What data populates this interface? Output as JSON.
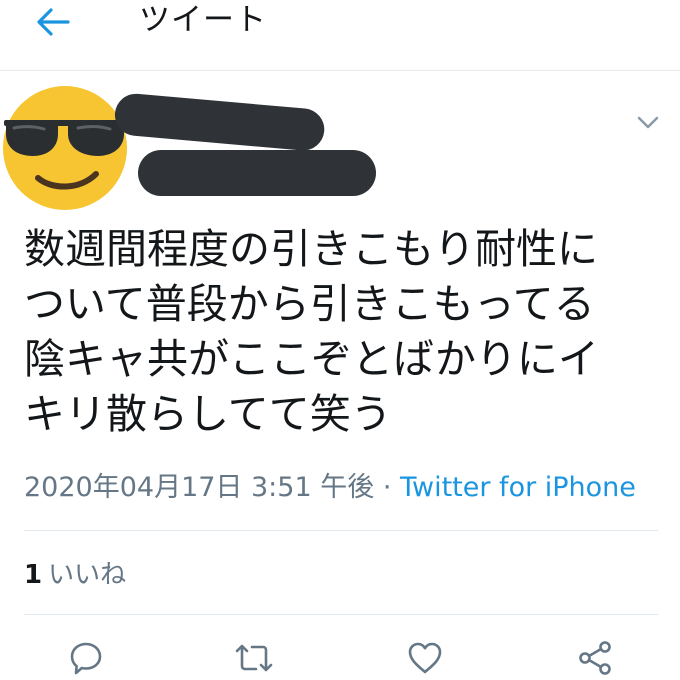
{
  "header": {
    "title": "ツイート",
    "back_icon": "arrow-left-icon"
  },
  "author": {
    "avatar_icon": "sunglasses-emoji-avatar",
    "name_redacted": true,
    "handle_redacted": true
  },
  "tweet": {
    "lines": [
      "数週間程度の引きこもり耐性に",
      "ついて普段から引きこもってる",
      "陰キャ共がここぞとばかりにイ",
      "キリ散らしてて笑う"
    ],
    "timestamp": "2020年04月17日 3:51 午後",
    "separator": " · ",
    "source": "Twitter for iPhone"
  },
  "stats": {
    "likes_count": "1",
    "likes_label": "いいね"
  },
  "actions": [
    {
      "name": "reply",
      "icon": "reply-icon"
    },
    {
      "name": "retweet",
      "icon": "retweet-icon"
    },
    {
      "name": "like",
      "icon": "heart-icon"
    },
    {
      "name": "share",
      "icon": "share-icon"
    }
  ],
  "colors": {
    "accent": "#1b95e0",
    "text": "#14171a",
    "secondary": "#657786",
    "redaction": "#2f3337",
    "avatar": "#f7c531"
  }
}
